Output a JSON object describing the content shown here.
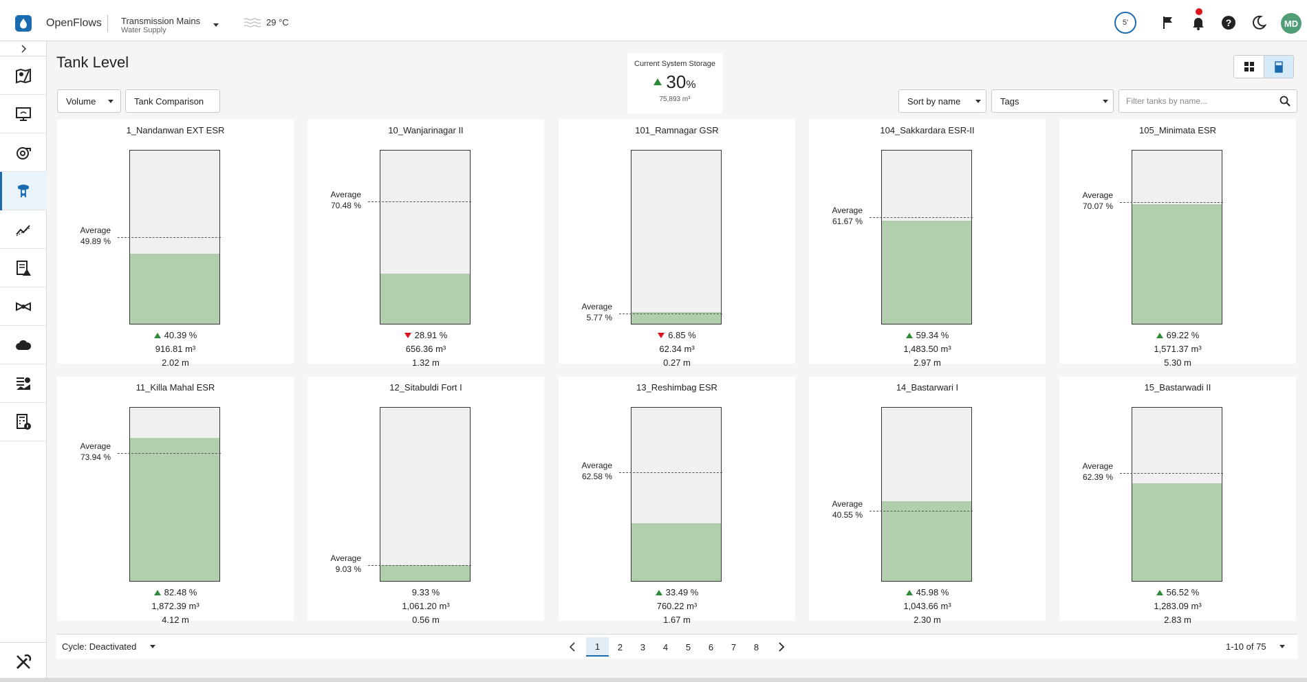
{
  "app": {
    "title": "OpenFlows",
    "project": "Transmission Mains",
    "project_sub": "Water Supply",
    "temperature": "29 °C",
    "refresh_label": "5'",
    "user_initials": "MD"
  },
  "sidebar": {
    "items": [
      {
        "icon": "map-icon"
      },
      {
        "icon": "monitor-icon"
      },
      {
        "icon": "pump-icon"
      },
      {
        "icon": "tank-icon",
        "active": true
      },
      {
        "icon": "analytics-icon"
      },
      {
        "icon": "alerts-report-icon"
      },
      {
        "icon": "valve-icon"
      },
      {
        "icon": "cloud-icon"
      },
      {
        "icon": "dashboard-icon"
      },
      {
        "icon": "calculator-info-icon"
      }
    ],
    "bottom_icon": "tools-icon"
  },
  "page": {
    "title": "Tank Level",
    "volume_label": "Volume",
    "comparison_label": "Tank Comparison",
    "sort_label": "Sort by name",
    "tags_label": "Tags",
    "filter_placeholder": "Filter tanks by name..."
  },
  "storage": {
    "label": "Current System Storage",
    "value": "30",
    "unit": "%",
    "volume": "75,893 m³",
    "trend": "up"
  },
  "colors": {
    "accent": "#1a6bb0",
    "fill": "#b1cfac",
    "up": "#2e8b3a",
    "down": "#d9121b"
  },
  "tanks": [
    {
      "name": "1_Nandanwan EXT ESR",
      "level": 40.39,
      "percent": "40.39 %",
      "trend": "up",
      "volume": "916.81 m³",
      "height": "2.02 m",
      "avg": 49.89,
      "avg_label": "Average",
      "avg_value": "49.89 %"
    },
    {
      "name": "10_Wanjarinagar II",
      "level": 28.91,
      "percent": "28.91 %",
      "trend": "down",
      "volume": "656.36 m³",
      "height": "1.32 m",
      "avg": 70.48,
      "avg_label": "Average",
      "avg_value": "70.48 %"
    },
    {
      "name": "101_Ramnagar GSR",
      "level": 6.85,
      "percent": "6.85 %",
      "trend": "down",
      "volume": "62.34 m³",
      "height": "0.27 m",
      "avg": 5.77,
      "avg_label": "Average",
      "avg_value": "5.77 %"
    },
    {
      "name": "104_Sakkardara ESR-II",
      "level": 59.34,
      "percent": "59.34 %",
      "trend": "up",
      "volume": "1,483.50 m³",
      "height": "2.97 m",
      "avg": 61.67,
      "avg_label": "Average",
      "avg_value": "61.67 %"
    },
    {
      "name": "105_Minimata ESR",
      "level": 69.22,
      "percent": "69.22 %",
      "trend": "up",
      "volume": "1,571.37 m³",
      "height": "5.30 m",
      "avg": 70.07,
      "avg_label": "Average",
      "avg_value": "70.07 %"
    },
    {
      "name": "11_Killa Mahal ESR",
      "level": 82.48,
      "percent": "82.48 %",
      "trend": "up",
      "volume": "1,872.39 m³",
      "height": "4.12 m",
      "avg": 73.94,
      "avg_label": "Average",
      "avg_value": "73.94 %"
    },
    {
      "name": "12_Sitabuldi Fort I",
      "level": 9.33,
      "percent": "9.33 %",
      "trend": "none",
      "volume": "1,061.20 m³",
      "height": "0.56 m",
      "avg": 9.03,
      "avg_label": "Average",
      "avg_value": "9.03 %"
    },
    {
      "name": "13_Reshimbag ESR",
      "level": 33.49,
      "percent": "33.49 %",
      "trend": "up",
      "volume": "760.22 m³",
      "height": "1.67 m",
      "avg": 62.58,
      "avg_label": "Average",
      "avg_value": "62.58 %"
    },
    {
      "name": "14_Bastarwari I",
      "level": 45.98,
      "percent": "45.98 %",
      "trend": "up",
      "volume": "1,043.66 m³",
      "height": "2.30 m",
      "avg": 40.55,
      "avg_label": "Average",
      "avg_value": "40.55 %"
    },
    {
      "name": "15_Bastarwadi II",
      "level": 56.52,
      "percent": "56.52 %",
      "trend": "up",
      "volume": "1,283.09 m³",
      "height": "2.83 m",
      "avg": 62.39,
      "avg_label": "Average",
      "avg_value": "62.39 %"
    }
  ],
  "footer": {
    "cycle": "Cycle: Deactivated",
    "pages": [
      "1",
      "2",
      "3",
      "4",
      "5",
      "6",
      "7",
      "8"
    ],
    "current_page": "1",
    "range": "1-10 of 75"
  }
}
